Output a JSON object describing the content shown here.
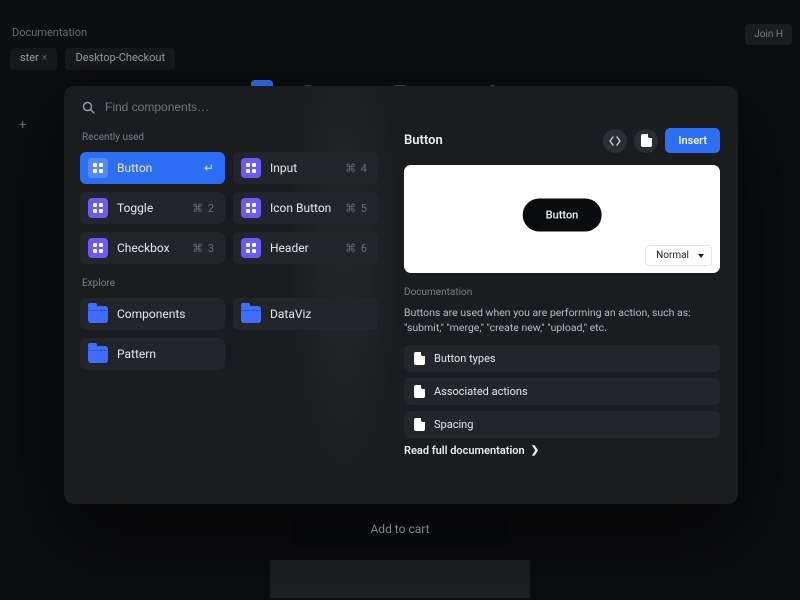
{
  "backdrop": {
    "breadcrumb": "Documentation",
    "tabs": [
      "ster",
      "Desktop-Checkout"
    ],
    "join_label": "Join H",
    "addcart_label": "Add to cart"
  },
  "search": {
    "placeholder": "Find components…"
  },
  "sections": {
    "recent": "Recently used",
    "explore": "Explore"
  },
  "recent": [
    {
      "label": "Button",
      "shortcut": "↵"
    },
    {
      "label": "Input",
      "shortcut": "⌘ 4"
    },
    {
      "label": "Toggle",
      "shortcut": "⌘ 2"
    },
    {
      "label": "Icon Button",
      "shortcut": "⌘ 5"
    },
    {
      "label": "Checkbox",
      "shortcut": "⌘ 3"
    },
    {
      "label": "Header",
      "shortcut": "⌘ 6"
    }
  ],
  "explore": [
    {
      "label": "Components"
    },
    {
      "label": "DataViz"
    },
    {
      "label": "Pattern"
    }
  ],
  "detail": {
    "title": "Button",
    "insert_label": "Insert",
    "preview_button_label": "Button",
    "variant_selected": "Normal",
    "doc_section": "Documentation",
    "doc_text": "Buttons are used when you are performing an action, such as: \"submit,\" \"merge,\" \"create new,\" \"upload,\" etc.",
    "links": [
      "Button types",
      "Associated actions",
      "Spacing"
    ],
    "read_full": "Read full documentation"
  }
}
